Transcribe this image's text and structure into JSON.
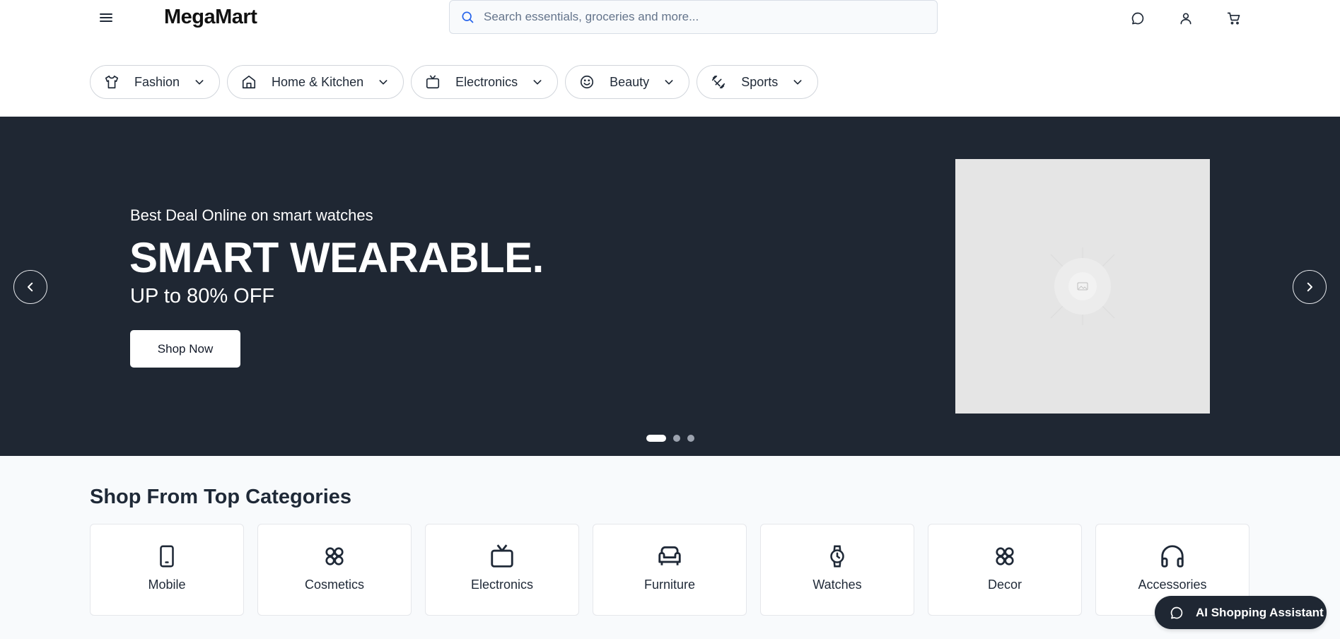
{
  "header": {
    "logo": "MegaMart",
    "search_placeholder": "Search essentials, groceries and more...",
    "icons": [
      "menu-icon",
      "search-icon",
      "chat-icon",
      "user-icon",
      "cart-icon"
    ]
  },
  "nav": {
    "pills": [
      {
        "label": "Fashion",
        "icon": "shirt-icon"
      },
      {
        "label": "Home & Kitchen",
        "icon": "home-icon"
      },
      {
        "label": "Electronics",
        "icon": "tv-icon"
      },
      {
        "label": "Beauty",
        "icon": "smile-icon"
      },
      {
        "label": "Sports",
        "icon": "dumbbell-icon"
      }
    ]
  },
  "hero": {
    "subtitle": "Best Deal Online on smart watches",
    "title": "SMART WEARABLE.",
    "offer": "UP to 80% OFF",
    "cta": "Shop Now",
    "slides": 3,
    "active_slide": 1
  },
  "categories": {
    "title": "Shop From Top Categories",
    "items": [
      {
        "label": "Mobile",
        "icon": "smartphone-icon"
      },
      {
        "label": "Cosmetics",
        "icon": "flower-icon"
      },
      {
        "label": "Electronics",
        "icon": "tv-icon"
      },
      {
        "label": "Furniture",
        "icon": "sofa-icon"
      },
      {
        "label": "Watches",
        "icon": "watch-icon"
      },
      {
        "label": "Decor",
        "icon": "flower-icon"
      },
      {
        "label": "Accessories",
        "icon": "headphones-icon"
      }
    ]
  },
  "assistant": {
    "label": "AI Shopping Assistant"
  },
  "colors": {
    "hero_bg": "#1f2733",
    "section_bg": "#f8fafc",
    "accent": "#ffffff"
  }
}
